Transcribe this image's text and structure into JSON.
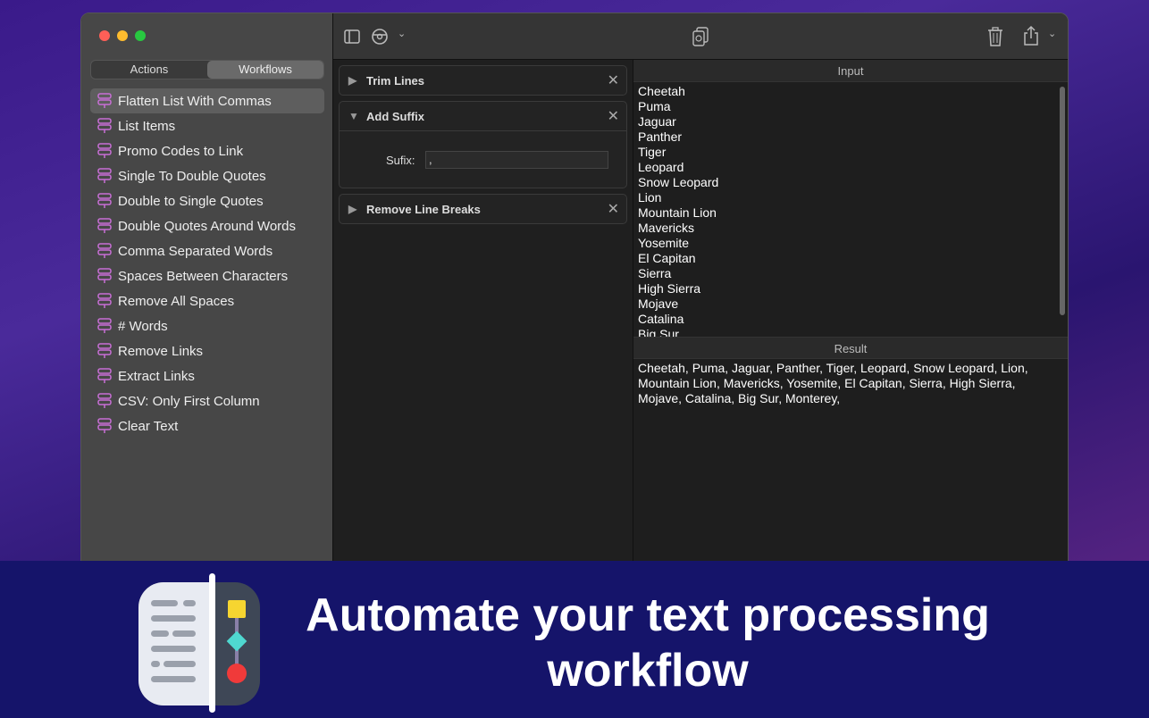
{
  "sidebar": {
    "tabs": [
      {
        "label": "Actions",
        "active": false
      },
      {
        "label": "Workflows",
        "active": true
      }
    ],
    "items": [
      "Flatten List With Commas",
      "List Items",
      "Promo Codes to Link",
      "Single To Double Quotes",
      "Double to Single Quotes",
      "Double Quotes Around Words",
      "Comma Separated Words",
      "Spaces Between Characters",
      "Remove All Spaces",
      "# Words",
      "Remove Links",
      "Extract Links",
      "CSV: Only First Column",
      "Clear Text"
    ],
    "selected_index": 0
  },
  "steps": [
    {
      "title": "Trim Lines",
      "expanded": false
    },
    {
      "title": "Add Suffix",
      "expanded": true,
      "field_label": "Sufix:",
      "field_value": ","
    },
    {
      "title": "Remove Line Breaks",
      "expanded": false
    }
  ],
  "input": {
    "header": "Input",
    "lines": [
      "Cheetah",
      "Puma",
      "Jaguar",
      "Panther",
      "Tiger",
      "Leopard",
      "Snow Leopard",
      "Lion",
      "Mountain Lion",
      "Mavericks",
      "Yosemite",
      "El Capitan",
      "Sierra",
      "High Sierra",
      "Mojave",
      "Catalina",
      "Big Sur"
    ]
  },
  "result": {
    "header": "Result",
    "text": "Cheetah, Puma, Jaguar, Panther, Tiger, Leopard, Snow Leopard, Lion, Mountain Lion, Mavericks, Yosemite, El Capitan, Sierra, High Sierra, Mojave, Catalina, Big Sur, Monterey,"
  },
  "banner": {
    "tagline": "Automate your text processing workflow"
  },
  "colors": {
    "workflow_icon": "#c86fd6",
    "banner_bg": "#15146a",
    "close": "#fe5f57",
    "minimize": "#febc2e",
    "zoom": "#28c840"
  }
}
